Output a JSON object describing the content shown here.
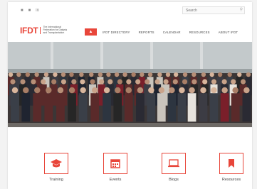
{
  "topbar": {
    "social": [
      {
        "icon": "twitter-icon",
        "glyph": "■"
      },
      {
        "icon": "facebook-icon",
        "glyph": "■"
      },
      {
        "icon": "linkedin-icon",
        "glyph": "in"
      }
    ],
    "search_placeholder": "Search"
  },
  "header": {
    "logo_mark": "IFDT",
    "logo_text": "The International Federation for Dialysis and Transplantation"
  },
  "nav": {
    "home_icon": "home-icon",
    "items": [
      "IFDT DIRECTORY",
      "REPORTS",
      "CALENDAR",
      "RESOURCES",
      "ABOUT IFDT"
    ]
  },
  "hero": {
    "caption": ""
  },
  "features": [
    {
      "label": "Training",
      "icon": "graduation-cap-icon"
    },
    {
      "label": "Events",
      "icon": "calendar-icon"
    },
    {
      "label": "Blogs",
      "icon": "laptop-icon"
    },
    {
      "label": "Resources",
      "icon": "bookmark-icon"
    }
  ],
  "colors": {
    "accent": "#e8463a",
    "page_bg": "#ffffff",
    "outer_bg": "#f3f3f3"
  }
}
